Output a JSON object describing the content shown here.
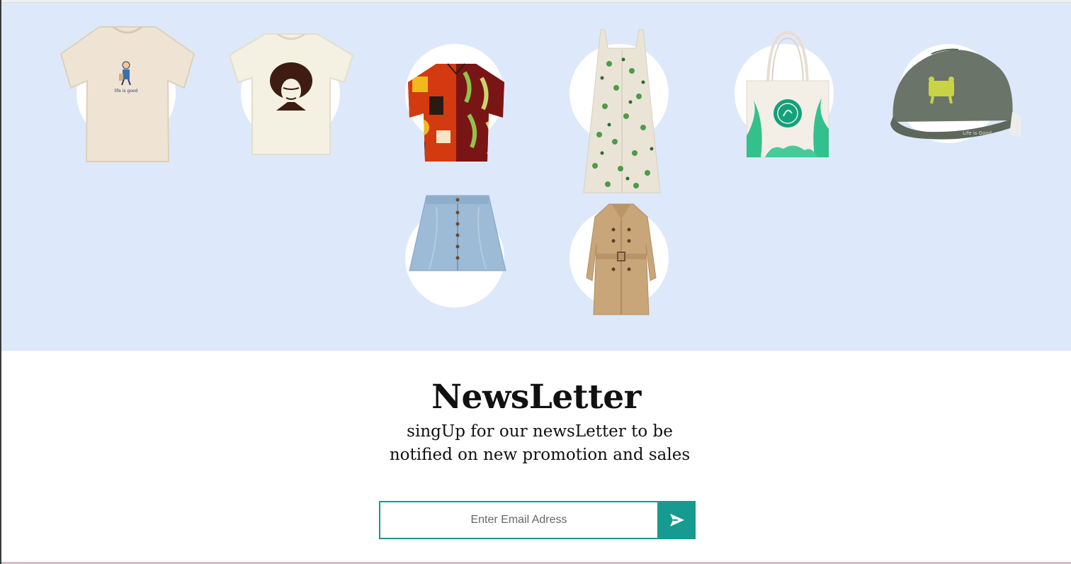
{
  "gallery": {
    "items": [
      {
        "name": "Cream graphic t-shirt"
      },
      {
        "name": "Portrait print t-shirt"
      },
      {
        "name": "Patterned short-sleeve shirt"
      },
      {
        "name": "Floral sundress"
      },
      {
        "name": "Canvas tote bag"
      },
      {
        "name": "Olive baseball cap"
      },
      {
        "name": "Denim button-front skirt"
      },
      {
        "name": "Beige trench coat"
      }
    ],
    "tee_print_text": "life is good",
    "cap_print_text": "Life is Good"
  },
  "newsletter": {
    "title": "NewsLetter",
    "subtitle": "singUp for our newsLetter to be notified on new promotion and sales",
    "email_placeholder": "Enter Email Adress",
    "submit_icon": "send-arrow-icon"
  },
  "colors": {
    "gallery_bg": "#dde9fa",
    "accent": "#179a8f"
  }
}
